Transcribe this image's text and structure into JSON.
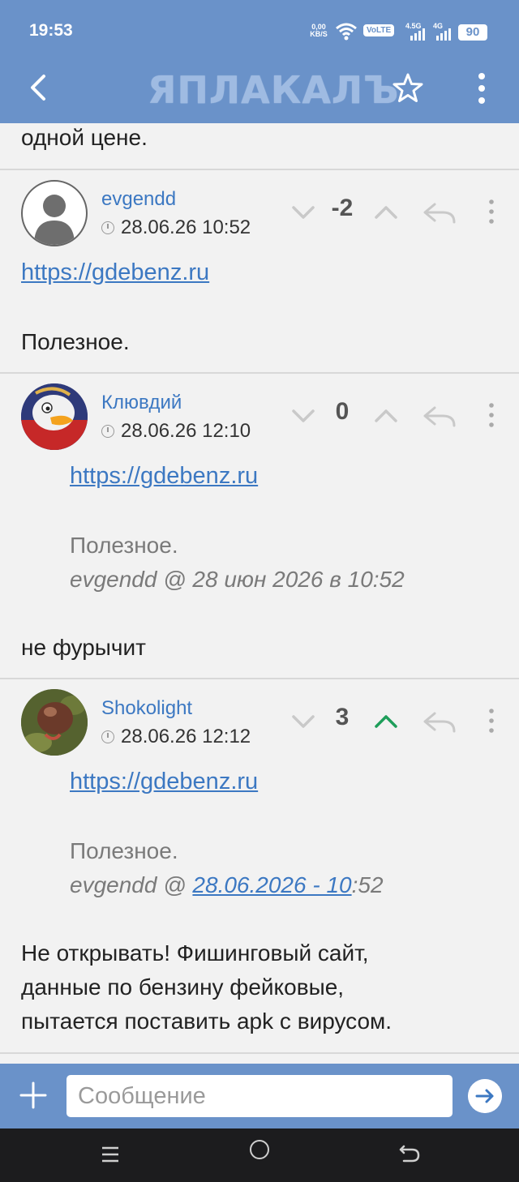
{
  "status_bar": {
    "time": "19:53",
    "net_speed": "0,00",
    "net_unit": "KB/S",
    "volte": "VoLTE",
    "sig1_label": "4.5G",
    "sig2_label": "4G",
    "battery": "90"
  },
  "app_bar": {
    "logo": "ЯПЛАКАЛЪ"
  },
  "feed": {
    "prev_text": "одной цене.",
    "comments": [
      {
        "author": "evgendd",
        "date": "28.06.26 10:52",
        "score": "-2",
        "link": "https://gdebenz.ru",
        "text": "Полезное.",
        "upvoted": false
      },
      {
        "author": "Клювдий",
        "date": "28.06.26 12:10",
        "score": "0",
        "quote_link": "https://gdebenz.ru",
        "quote_text": "Полезное.",
        "quote_sig": "evgendd @ 28 июн 2026 в 10:52",
        "text": "не фурычит",
        "upvoted": false
      },
      {
        "author": "Shokolight",
        "date": "28.06.26 12:12",
        "score": "3",
        "quote_link": "https://gdebenz.ru",
        "quote_text": "Полезное.",
        "quote_sig_prefix": "evgendd @ ",
        "quote_sig_link": "28.06.2026 - 10",
        "quote_sig_suffix": ":52",
        "text_line1": "Не открывать! Фишинговый сайт,",
        "text_line2": "данные по бензину фейковые,",
        "text_line3": "пытается поставить apk с вирусом.",
        "upvoted": true
      }
    ]
  },
  "composer": {
    "placeholder": "Сообщение"
  },
  "colors": {
    "app_bar": "#6a92c9",
    "link": "#3c78c2",
    "upvote_active": "#1e9e5a"
  }
}
